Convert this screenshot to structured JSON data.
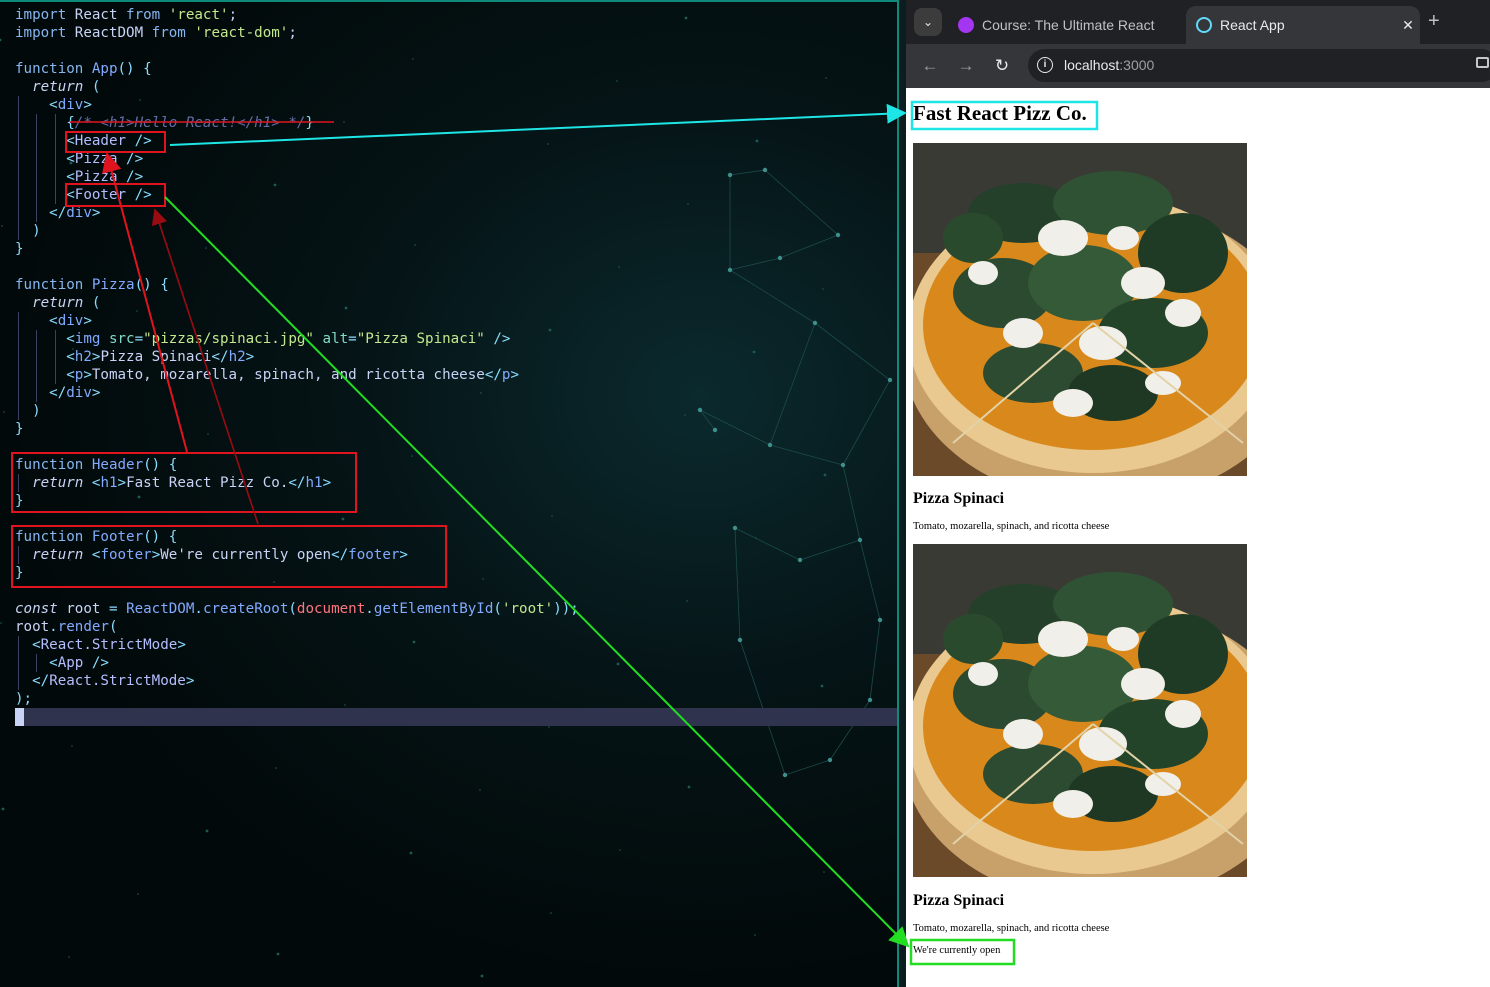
{
  "editor": {
    "lines": [
      {
        "t": [
          [
            "kw",
            "import"
          ],
          [
            "",
            " React "
          ],
          [
            "kw",
            "from"
          ],
          [
            "",
            " "
          ],
          [
            "str",
            "'react'"
          ],
          [
            "",
            ";"
          ]
        ]
      },
      {
        "t": [
          [
            "kw",
            "import"
          ],
          [
            "",
            " ReactDOM "
          ],
          [
            "kw",
            "from"
          ],
          [
            "",
            " "
          ],
          [
            "str",
            "'react-dom'"
          ],
          [
            "",
            ";"
          ]
        ]
      },
      {
        "t": []
      },
      {
        "t": [
          [
            "kw",
            "function"
          ],
          [
            "",
            " "
          ],
          [
            "fn",
            "App"
          ],
          [
            "pn",
            "() {"
          ]
        ]
      },
      {
        "t": [
          [
            "",
            "  "
          ],
          [
            "it",
            "return"
          ],
          [
            "",
            " "
          ],
          [
            "pn",
            "("
          ]
        ]
      },
      {
        "t": [
          [
            "",
            "    "
          ],
          [
            "pn",
            "<"
          ],
          [
            "tag",
            "div"
          ],
          [
            "pn",
            ">"
          ]
        ]
      },
      {
        "t": [
          [
            "",
            "      "
          ],
          [
            "pn",
            "{"
          ],
          [
            "cmt",
            "/* <h1>Hello React!</h1> */"
          ],
          [
            "pn",
            "}"
          ]
        ]
      },
      {
        "t": [
          [
            "",
            "      "
          ],
          [
            "pn",
            "<"
          ],
          [
            "cmp",
            "Header"
          ],
          [
            "pn",
            " />"
          ]
        ]
      },
      {
        "t": [
          [
            "",
            "      "
          ],
          [
            "pn",
            "<"
          ],
          [
            "cmp",
            "Pizza"
          ],
          [
            "pn",
            " />"
          ]
        ]
      },
      {
        "t": [
          [
            "",
            "      "
          ],
          [
            "pn",
            "<"
          ],
          [
            "cmp",
            "Pizza"
          ],
          [
            "pn",
            " />"
          ]
        ]
      },
      {
        "t": [
          [
            "",
            "      "
          ],
          [
            "pn",
            "<"
          ],
          [
            "cmp",
            "Footer"
          ],
          [
            "pn",
            " />"
          ]
        ]
      },
      {
        "t": [
          [
            "",
            "    "
          ],
          [
            "pn",
            "</"
          ],
          [
            "tag",
            "div"
          ],
          [
            "pn",
            ">"
          ]
        ]
      },
      {
        "t": [
          [
            "",
            "  "
          ],
          [
            "pn",
            ")"
          ]
        ]
      },
      {
        "t": [
          [
            "pn",
            "}"
          ]
        ]
      },
      {
        "t": []
      },
      {
        "t": [
          [
            "kw",
            "function"
          ],
          [
            "",
            " "
          ],
          [
            "fn",
            "Pizza"
          ],
          [
            "pn",
            "() {"
          ]
        ]
      },
      {
        "t": [
          [
            "",
            "  "
          ],
          [
            "it",
            "return"
          ],
          [
            "",
            " "
          ],
          [
            "pn",
            "("
          ]
        ]
      },
      {
        "t": [
          [
            "",
            "    "
          ],
          [
            "pn",
            "<"
          ],
          [
            "tag",
            "div"
          ],
          [
            "pn",
            ">"
          ]
        ]
      },
      {
        "t": [
          [
            "",
            "      "
          ],
          [
            "pn",
            "<"
          ],
          [
            "tag",
            "img"
          ],
          [
            "",
            " "
          ],
          [
            "attr",
            "src"
          ],
          [
            "pn",
            "="
          ],
          [
            "str",
            "\"pizzas/spinaci.jpg\""
          ],
          [
            "",
            " "
          ],
          [
            "attr",
            "alt"
          ],
          [
            "pn",
            "="
          ],
          [
            "str",
            "\"Pizza Spinaci\""
          ],
          [
            "pn",
            " />"
          ]
        ]
      },
      {
        "t": [
          [
            "",
            "      "
          ],
          [
            "pn",
            "<"
          ],
          [
            "tag",
            "h2"
          ],
          [
            "pn",
            ">"
          ],
          [
            "",
            "Pizza Spinaci"
          ],
          [
            "pn",
            "</"
          ],
          [
            "tag",
            "h2"
          ],
          [
            "pn",
            ">"
          ]
        ]
      },
      {
        "t": [
          [
            "",
            "      "
          ],
          [
            "pn",
            "<"
          ],
          [
            "tag",
            "p"
          ],
          [
            "pn",
            ">"
          ],
          [
            "",
            "Tomato, mozarella, spinach, and ricotta cheese"
          ],
          [
            "pn",
            "</"
          ],
          [
            "tag",
            "p"
          ],
          [
            "pn",
            ">"
          ]
        ]
      },
      {
        "t": [
          [
            "",
            "    "
          ],
          [
            "pn",
            "</"
          ],
          [
            "tag",
            "div"
          ],
          [
            "pn",
            ">"
          ]
        ]
      },
      {
        "t": [
          [
            "",
            "  "
          ],
          [
            "pn",
            ")"
          ]
        ]
      },
      {
        "t": [
          [
            "pn",
            "}"
          ]
        ]
      },
      {
        "t": []
      },
      {
        "t": [
          [
            "kw",
            "function"
          ],
          [
            "",
            " "
          ],
          [
            "fn",
            "Header"
          ],
          [
            "pn",
            "() {"
          ]
        ]
      },
      {
        "t": [
          [
            "",
            "  "
          ],
          [
            "it",
            "return"
          ],
          [
            "",
            " "
          ],
          [
            "pn",
            "<"
          ],
          [
            "tag",
            "h1"
          ],
          [
            "pn",
            ">"
          ],
          [
            "",
            "Fast React Pizz Co."
          ],
          [
            "pn",
            "</"
          ],
          [
            "tag",
            "h1"
          ],
          [
            "pn",
            ">"
          ]
        ]
      },
      {
        "t": [
          [
            "pn",
            "}"
          ]
        ]
      },
      {
        "t": []
      },
      {
        "t": [
          [
            "kw",
            "function"
          ],
          [
            "",
            " "
          ],
          [
            "fn",
            "Footer"
          ],
          [
            "pn",
            "() {"
          ]
        ]
      },
      {
        "t": [
          [
            "",
            "  "
          ],
          [
            "it",
            "return"
          ],
          [
            "",
            " "
          ],
          [
            "pn",
            "<"
          ],
          [
            "tag",
            "footer"
          ],
          [
            "pn",
            ">"
          ],
          [
            "",
            "We're currently open"
          ],
          [
            "pn",
            "</"
          ],
          [
            "tag",
            "footer"
          ],
          [
            "pn",
            ">"
          ]
        ]
      },
      {
        "t": [
          [
            "pn",
            "}"
          ]
        ]
      },
      {
        "t": []
      },
      {
        "t": [
          [
            "it",
            "const"
          ],
          [
            "",
            " root "
          ],
          [
            "pn",
            "="
          ],
          [
            "",
            " "
          ],
          [
            "fn",
            "ReactDOM"
          ],
          [
            "pn",
            "."
          ],
          [
            "fn",
            "createRoot"
          ],
          [
            "pn",
            "("
          ],
          [
            "red",
            "document"
          ],
          [
            "pn",
            "."
          ],
          [
            "fn",
            "getElementById"
          ],
          [
            "pn",
            "("
          ],
          [
            "str",
            "'root'"
          ],
          [
            "pn",
            "));"
          ]
        ]
      },
      {
        "t": [
          [
            "",
            "root"
          ],
          [
            "pn",
            "."
          ],
          [
            "fn",
            "render"
          ],
          [
            "pn",
            "("
          ]
        ]
      },
      {
        "t": [
          [
            "",
            "  "
          ],
          [
            "pn",
            "<"
          ],
          [
            "cmp",
            "React.StrictMode"
          ],
          [
            "pn",
            ">"
          ]
        ]
      },
      {
        "t": [
          [
            "",
            "    "
          ],
          [
            "pn",
            "<"
          ],
          [
            "cmp",
            "App"
          ],
          [
            "pn",
            " />"
          ]
        ]
      },
      {
        "t": [
          [
            "",
            "  "
          ],
          [
            "pn",
            "</"
          ],
          [
            "cmp",
            "React.StrictMode"
          ],
          [
            "pn",
            ">"
          ]
        ]
      },
      {
        "t": [
          [
            "pn",
            ");"
          ]
        ]
      }
    ]
  },
  "browser": {
    "tabs": [
      {
        "title": "Course: The Ultimate React",
        "favicon_color": "#a435f0",
        "active": false
      },
      {
        "title": "React App",
        "favicon_color": "#61dafb",
        "active": true
      }
    ],
    "new_tab_symbol": "+",
    "url_host": "localhost",
    "url_port": ":3000"
  },
  "page": {
    "heading": "Fast React Pizz Co.",
    "pizzas": [
      {
        "name": "Pizza Spinaci",
        "ingredients": "Tomato, mozarella, spinach, and ricotta cheese"
      },
      {
        "name": "Pizza Spinaci",
        "ingredients": "Tomato, mozarella, spinach, and ricotta cheese"
      }
    ],
    "footer": "We're currently open"
  },
  "annotations": {
    "highlight_box_color": "#e0141e",
    "header_link_color": "#1ee6e6",
    "footer_link_color": "#22dd22"
  }
}
